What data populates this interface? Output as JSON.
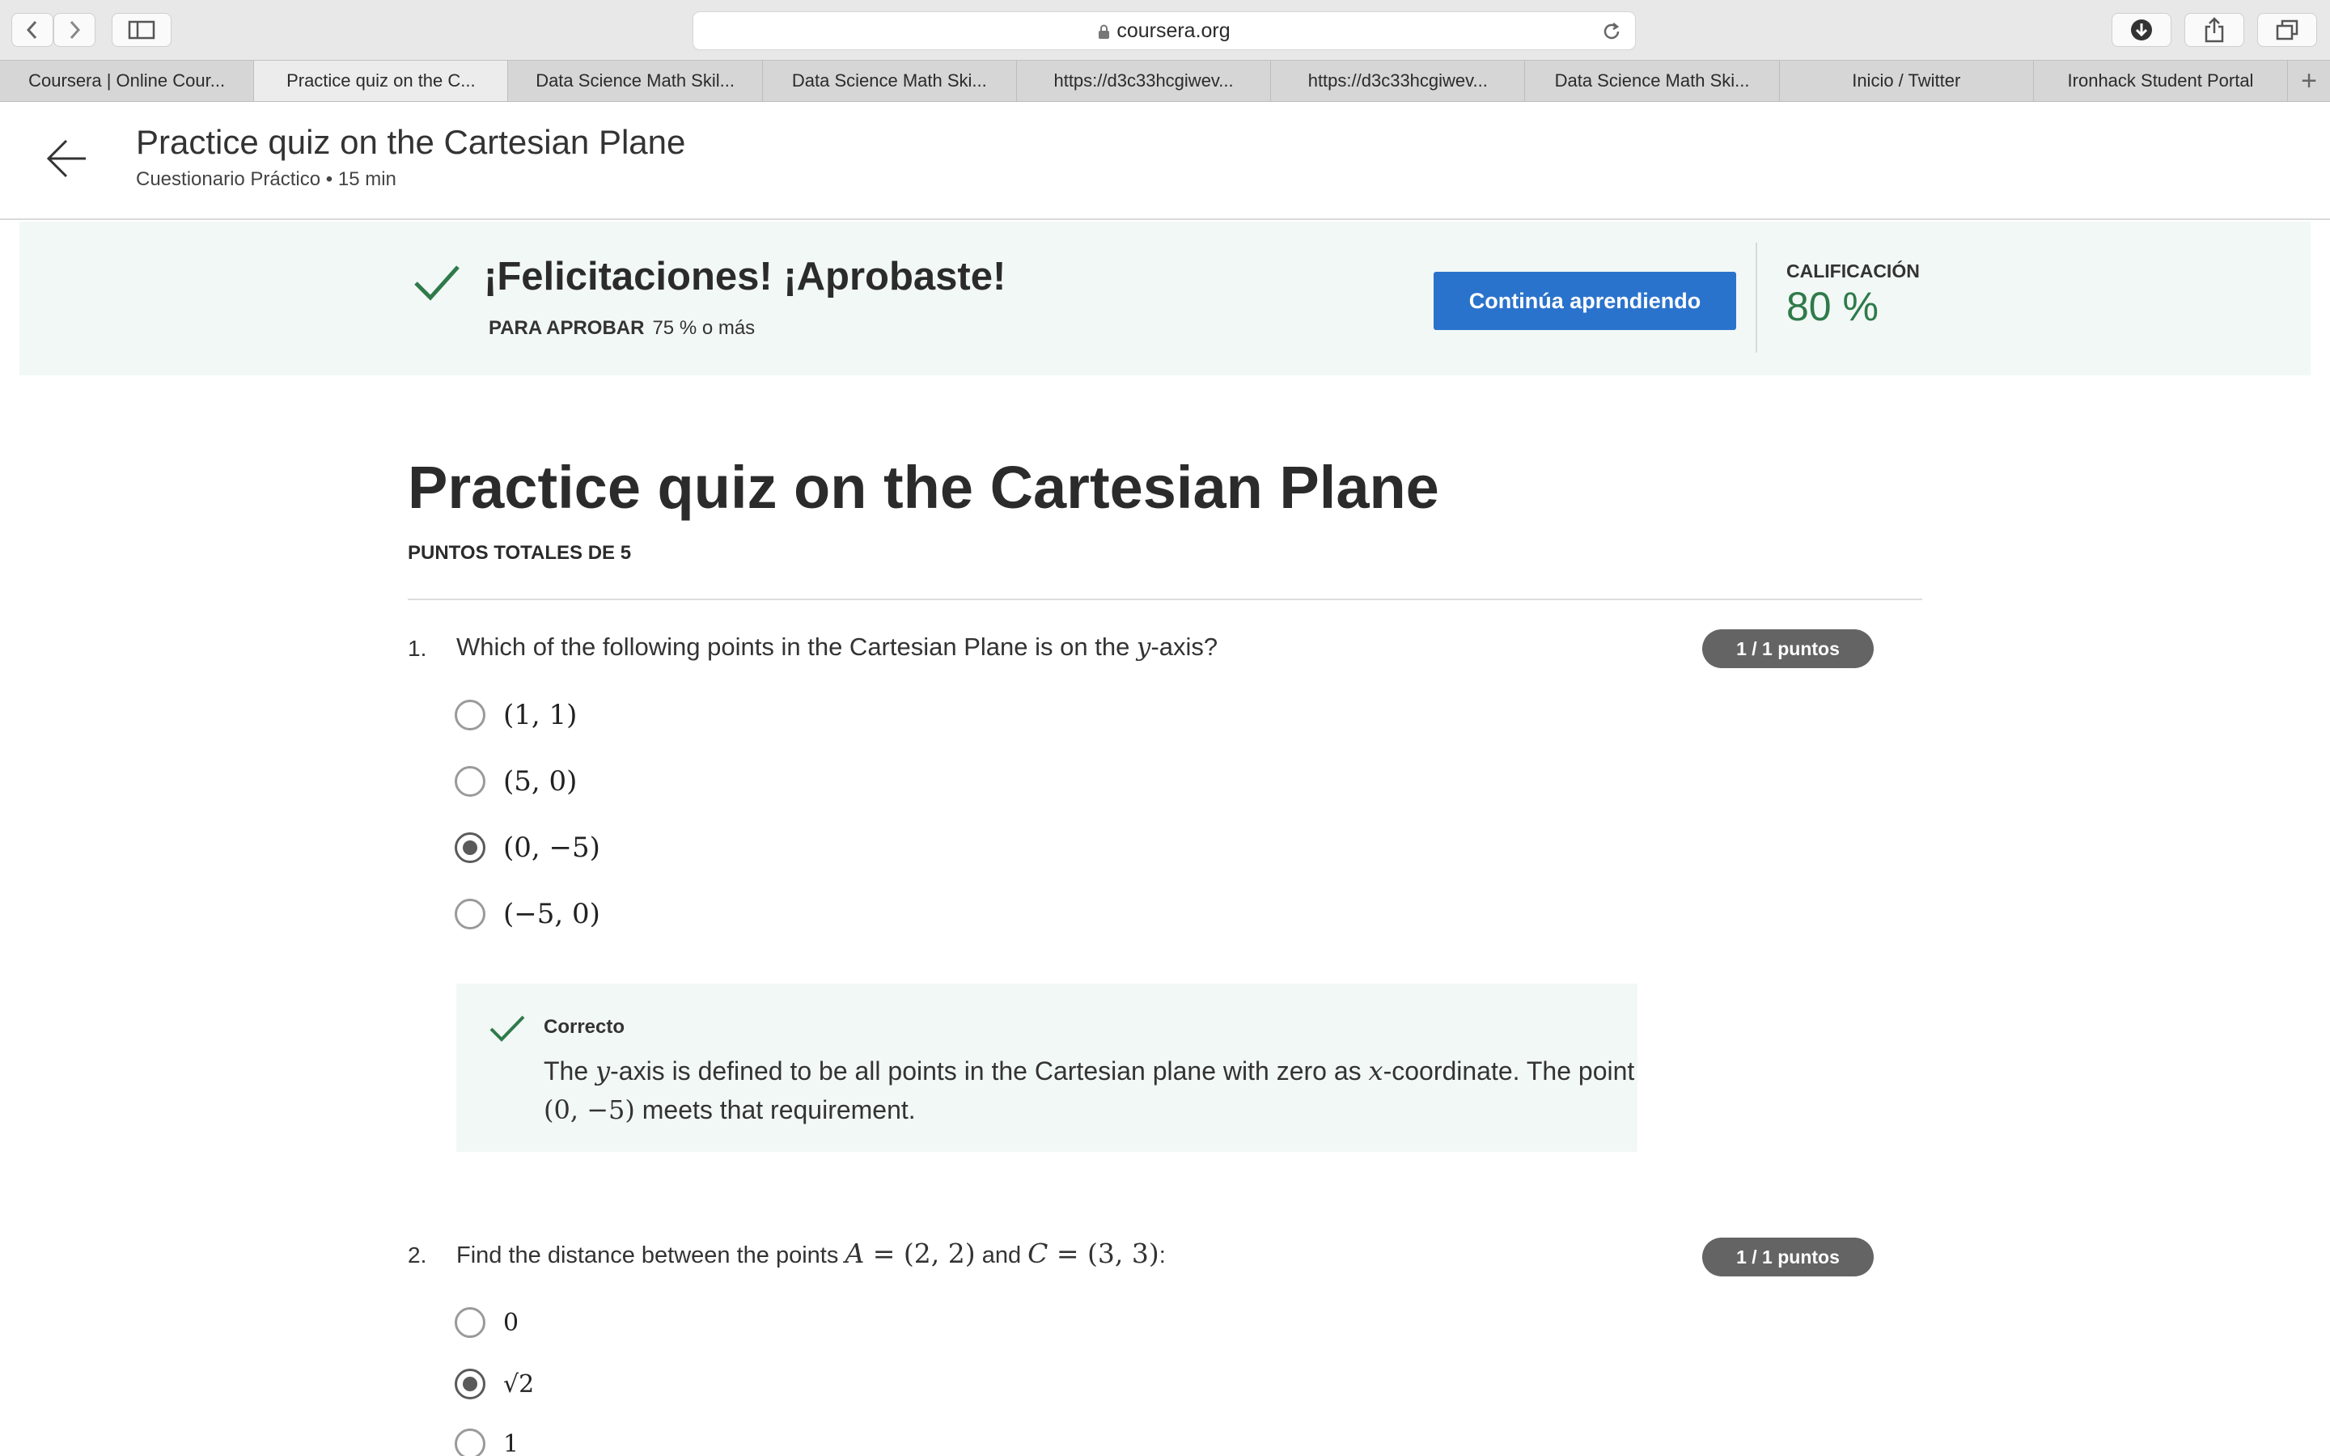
{
  "browser": {
    "url": "coursera.org",
    "tabs": [
      {
        "label": "Coursera | Online Cour...",
        "active": false
      },
      {
        "label": "Practice quiz on the C...",
        "active": true
      },
      {
        "label": "Data Science Math Skil...",
        "active": false
      },
      {
        "label": "Data Science Math Ski...",
        "active": false
      },
      {
        "label": "https://d3c33hcgiwev...",
        "active": false
      },
      {
        "label": "https://d3c33hcgiwev...",
        "active": false
      },
      {
        "label": "Data Science Math Ski...",
        "active": false
      },
      {
        "label": "Inicio / Twitter",
        "active": false
      },
      {
        "label": "Ironhack Student Portal",
        "active": false
      }
    ],
    "new_tab_symbol": "+"
  },
  "header": {
    "title": "Practice quiz on the Cartesian Plane",
    "subtitle": "Cuestionario Práctico • 15 min"
  },
  "banner": {
    "title": "¡Felicitaciones! ¡Aprobaste!",
    "pass_label": "PARA APROBAR",
    "pass_value": "75 % o más",
    "button_label": "Continúa aprendiendo",
    "grade_label": "CALIFICACIÓN",
    "grade_value": "80 %"
  },
  "quiz": {
    "title": "Practice quiz on the Cartesian Plane",
    "total_points": "PUNTOS TOTALES DE 5",
    "questions": [
      {
        "number": "1.",
        "text_before": "Which of the following points in the Cartesian Plane is on the ",
        "text_math": "y",
        "text_after": "-axis?",
        "score": "1 / 1 puntos",
        "options": [
          "(1, 1)",
          "(5, 0)",
          "(0, −5)",
          "(−5, 0)"
        ],
        "selected_index": 2,
        "feedback": {
          "title": "Correcto",
          "line1_a": "The ",
          "line1_math_y": "y",
          "line1_b": "-axis is defined to be all points in the Cartesian plane with zero as ",
          "line1_math_x": "x",
          "line1_c": "-coordinate. The point",
          "line2_math": "(0, −5)",
          "line2_text": " meets that requirement."
        }
      },
      {
        "number": "2.",
        "text_before": "Find the distance between the points ",
        "math_a": "A",
        "math_a_val": " = (2, 2)",
        "text_mid": " and ",
        "math_c": "C",
        "math_c_val": " = (3, 3)",
        "text_after": ":",
        "score": "1 / 1 puntos",
        "options": [
          "0",
          "√2",
          "1"
        ],
        "selected_index": 1
      }
    ]
  },
  "colors": {
    "accent_button": "#2a73cc",
    "success_green": "#2f7a4a",
    "banner_bg": "#f2f8f6",
    "score_pill": "#646464"
  }
}
